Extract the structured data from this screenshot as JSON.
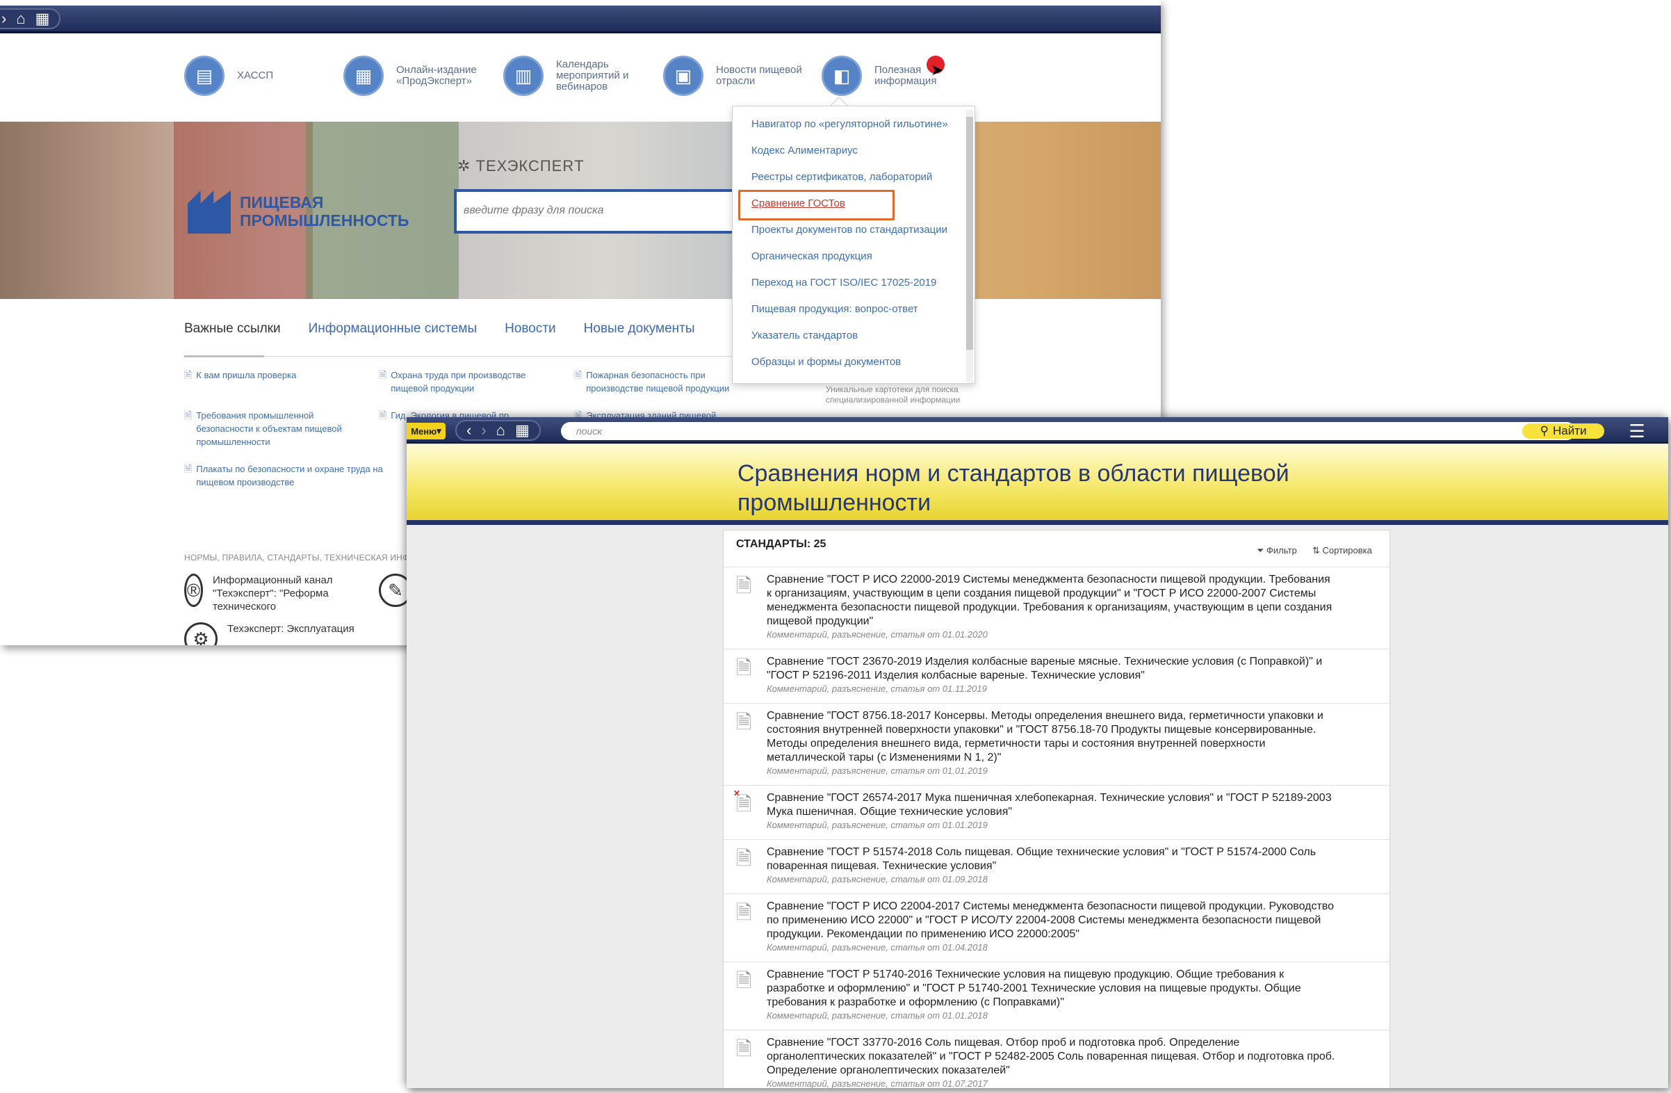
{
  "back_window": {
    "top_nav": [
      {
        "label": "ХАССП",
        "icon": "folders-icon"
      },
      {
        "label": "Онлайн-издание «ПродЭксперт»",
        "icon": "screen-icon"
      },
      {
        "label": "Календарь мероприятий и вебинаров",
        "icon": "calendar-icon"
      },
      {
        "label": "Новости пищевой отрасли",
        "icon": "newspaper-icon"
      },
      {
        "label": "Полезная информация",
        "icon": "info-board-icon"
      }
    ],
    "hero": {
      "logo_line1": "ПИЩЕВАЯ",
      "logo_line2": "ПРОМЫШЛЕННОСТЬ",
      "brand": "ТЕХЭКСПЕRТ",
      "search_placeholder": "введите фразу для поиска"
    },
    "tabs": [
      "Важные ссылки",
      "Информационные системы",
      "Новости",
      "Новые документы"
    ],
    "links_col1": [
      "К вам пришла проверка",
      "Требования промышленной безопасности к объектам пищевой промышленности",
      "Плакаты по безопасности и охране труда на пищевом производстве"
    ],
    "links_col2": [
      "Охрана труда при производстве пищевой продукции",
      "Гид. Экология в пищевой пр..."
    ],
    "links_col3": [
      "Пожарная безопасность при производстве пищевой продукции",
      "Эксплуатация зданий пищевой..."
    ],
    "extra_note": "Уникальные картотеки для поиска специализированной информации",
    "norms_caption": "НОРМЫ, ПРАВИЛА, СТАНДАРТЫ, ТЕХНИЧЕСКАЯ ИНФОРМА",
    "channels": [
      "Информационный канал \"Техэксперт\": \"Реформа технического",
      "Техэксперт: Эксплуатация"
    ],
    "dropdown_items": [
      "Навигатор по «регуляторной гильотине»",
      "Кодекс Алиментариус",
      "Реестры сертификатов, лабораторий",
      "Сравнение ГОСТов",
      "Проекты документов по стандартизации",
      "Органическая продукция",
      "Переход на ГОСТ ISO/IEC 17025-2019",
      "Пищевая продукция: вопрос-ответ",
      "Указатель стандартов",
      "Образцы и формы документов"
    ],
    "dropdown_selected_index": 3
  },
  "front_window": {
    "menu_label": "Меню",
    "search_placeholder": "поиск",
    "find_label": "Найти",
    "banner_title": "Сравнения норм и стандартов в области пищевой промышленности",
    "count_label": "СТАНДАРТЫ: 25",
    "filter_label": "Фильтр",
    "sort_label": "Сортировка",
    "documents": [
      {
        "title": "Сравнение \"ГОСТ Р ИСО 22000-2019 Системы менеджмента безопасности пищевой продукции. Требования к организациям, участвующим в цепи создания пищевой продукции\" и \"ГОСТ Р ИСО 22000-2007 Системы менеджмента безопасности пищевой продукции. Требования к организациям, участвующим в цепи создания пищевой продукции\"",
        "meta": "Комментарий, разъяснение, статья от 01.01.2020"
      },
      {
        "title": "Сравнение \"ГОСТ 23670-2019 Изделия колбасные вареные мясные. Технические условия (с Поправкой)\" и \"ГОСТ Р 52196-2011 Изделия колбасные вареные. Технические условия\"",
        "meta": "Комментарий, разъяснение, статья от 01.11.2019"
      },
      {
        "title": "Сравнение \"ГОСТ 8756.18-2017 Консервы. Методы определения внешнего вида, герметичности упаковки и состояния внутренней поверхности упаковки\" и \"ГОСТ 8756.18-70 Продукты пищевые консервированные. Методы определения внешнего вида, герметичности тары и состояния внутренней поверхности металлической тары (с Изменениями N 1, 2)\"",
        "meta": "Комментарий, разъяснение, статья от 01.01.2019"
      },
      {
        "title": "Сравнение \"ГОСТ 26574-2017 Мука пшеничная хлебопекарная. Технические условия\" и \"ГОСТ Р 52189-2003 Мука пшеничная. Общие технические условия\"",
        "meta": "Комментарий, разъяснение, статья от 01.01.2019"
      },
      {
        "title": "Сравнение \"ГОСТ Р 51574-2018 Соль пищевая. Общие технические условия\" и \"ГОСТ Р 51574-2000 Соль поваренная пищевая. Технические условия\"",
        "meta": "Комментарий, разъяснение, статья от 01.09.2018"
      },
      {
        "title": "Сравнение \"ГОСТ Р ИСО 22004-2017 Системы менеджмента безопасности пищевой продукции. Руководство по применению ИСО 22000\" и \"ГОСТ Р ИСО/ТУ 22004-2008 Системы менеджмента безопасности пищевой продукции. Рекомендации по применению ИСО 22000:2005\"",
        "meta": "Комментарий, разъяснение, статья от 01.04.2018"
      },
      {
        "title": "Сравнение \"ГОСТ Р 51740-2016 Технические условия на пищевую продукцию. Общие требования к разработке и оформлению\" и \"ГОСТ Р 51740-2001 Технические условия на пищевые продукты. Общие требования к разработке и оформлению (с Поправками)\"",
        "meta": "Комментарий, разъяснение, статья от 01.01.2018"
      },
      {
        "title": "Сравнение \"ГОСТ 33770-2016 Соль пищевая. Отбор проб и подготовка проб. Определение органолептических показателей\" и \"ГОСТ Р 52482-2005 Соль поваренная пищевая. Отбор и подготовка проб. Определение органолептических показателей\"",
        "meta": "Комментарий, разъяснение, статья от 01.07.2017"
      }
    ]
  }
}
